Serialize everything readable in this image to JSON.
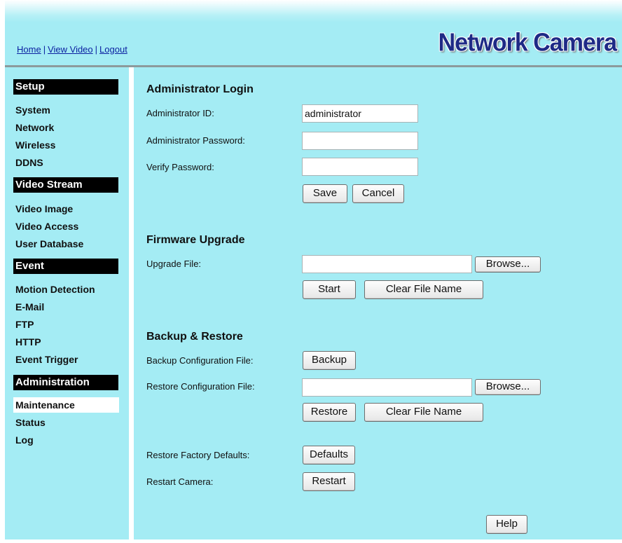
{
  "header": {
    "links": [
      "Home",
      "View Video",
      "Logout"
    ],
    "brand": "Network Camera"
  },
  "sidebar": {
    "sections": [
      {
        "title": "Setup",
        "items": [
          "System",
          "Network",
          "Wireless",
          "DDNS"
        ]
      },
      {
        "title": "Video Stream",
        "items": [
          "Video Image",
          "Video Access",
          "User Database"
        ]
      },
      {
        "title": "Event",
        "items": [
          "Motion Detection",
          "E-Mail",
          "FTP",
          "HTTP",
          "Event Trigger"
        ]
      },
      {
        "title": "Administration",
        "items": [
          "Maintenance",
          "Status",
          "Log"
        ]
      }
    ],
    "active_item": "Maintenance"
  },
  "main": {
    "admin_login": {
      "title": "Administrator Login",
      "id_label": "Administrator ID:",
      "id_value": "administrator",
      "password_label": "Administrator Password:",
      "password_value": "",
      "verify_label": "Verify Password:",
      "verify_value": "",
      "save": "Save",
      "cancel": "Cancel"
    },
    "firmware": {
      "title": "Firmware Upgrade",
      "file_label": "Upgrade File:",
      "file_value": "",
      "browse": "Browse...",
      "start": "Start",
      "clear": "Clear File Name"
    },
    "backup": {
      "title": "Backup & Restore",
      "backup_label": "Backup Configuration File:",
      "backup_button": "Backup",
      "restore_label": "Restore Configuration File:",
      "restore_file_value": "",
      "browse": "Browse...",
      "restore_button": "Restore",
      "clear": "Clear File Name"
    },
    "factory": {
      "label": "Restore Factory Defaults:",
      "button": "Defaults"
    },
    "restart": {
      "label": "Restart Camera:",
      "button": "Restart"
    },
    "help": "Help"
  }
}
